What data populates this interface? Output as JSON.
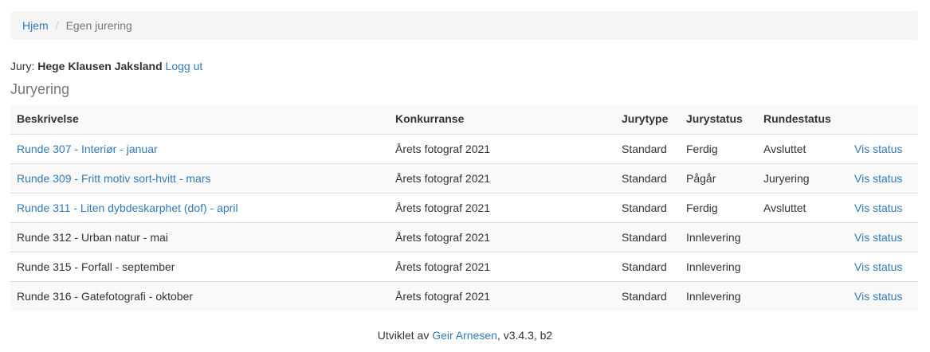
{
  "breadcrumb": {
    "home": "Hjem",
    "separator": "/",
    "current": "Egen jurering"
  },
  "jury": {
    "label": "Jury:",
    "name": "Hege Klausen Jaksland",
    "logout": "Logg ut"
  },
  "section_title": "Juryering",
  "table": {
    "headers": [
      "Beskrivelse",
      "Konkurranse",
      "Jurytype",
      "Jurystatus",
      "Rundestatus",
      ""
    ],
    "rows": [
      {
        "desc": "Runde 307 - Interiør - januar",
        "desc_link": true,
        "konk": "Årets fotograf 2021",
        "type": "Standard",
        "jstatus": "Ferdig",
        "rstatus": "Avsluttet",
        "action": "Vis status"
      },
      {
        "desc": "Runde 309 - Fritt motiv sort-hvitt - mars",
        "desc_link": true,
        "konk": "Årets fotograf 2021",
        "type": "Standard",
        "jstatus": "Pågår",
        "rstatus": "Juryering",
        "action": "Vis status"
      },
      {
        "desc": "Runde 311 - Liten dybdeskarphet (dof) - april",
        "desc_link": true,
        "konk": "Årets fotograf 2021",
        "type": "Standard",
        "jstatus": "Ferdig",
        "rstatus": "Avsluttet",
        "action": "Vis status"
      },
      {
        "desc": "Runde 312 - Urban natur - mai",
        "desc_link": false,
        "konk": "Årets fotograf 2021",
        "type": "Standard",
        "jstatus": "Innlevering",
        "rstatus": "",
        "action": "Vis status"
      },
      {
        "desc": "Runde 315 - Forfall - september",
        "desc_link": false,
        "konk": "Årets fotograf 2021",
        "type": "Standard",
        "jstatus": "Innlevering",
        "rstatus": "",
        "action": "Vis status"
      },
      {
        "desc": "Runde 316 - Gatefotografi - oktober",
        "desc_link": false,
        "konk": "Årets fotograf 2021",
        "type": "Standard",
        "jstatus": "Innlevering",
        "rstatus": "",
        "action": "Vis status"
      }
    ]
  },
  "footer": {
    "prefix": "Utviklet av",
    "author": "Geir Arnesen",
    "version": ", v3.4.3, b2"
  },
  "colors": {
    "link": "#337ab7",
    "breadcrumb_bg": "#f5f5f5",
    "stripe": "#f9f9f9"
  }
}
